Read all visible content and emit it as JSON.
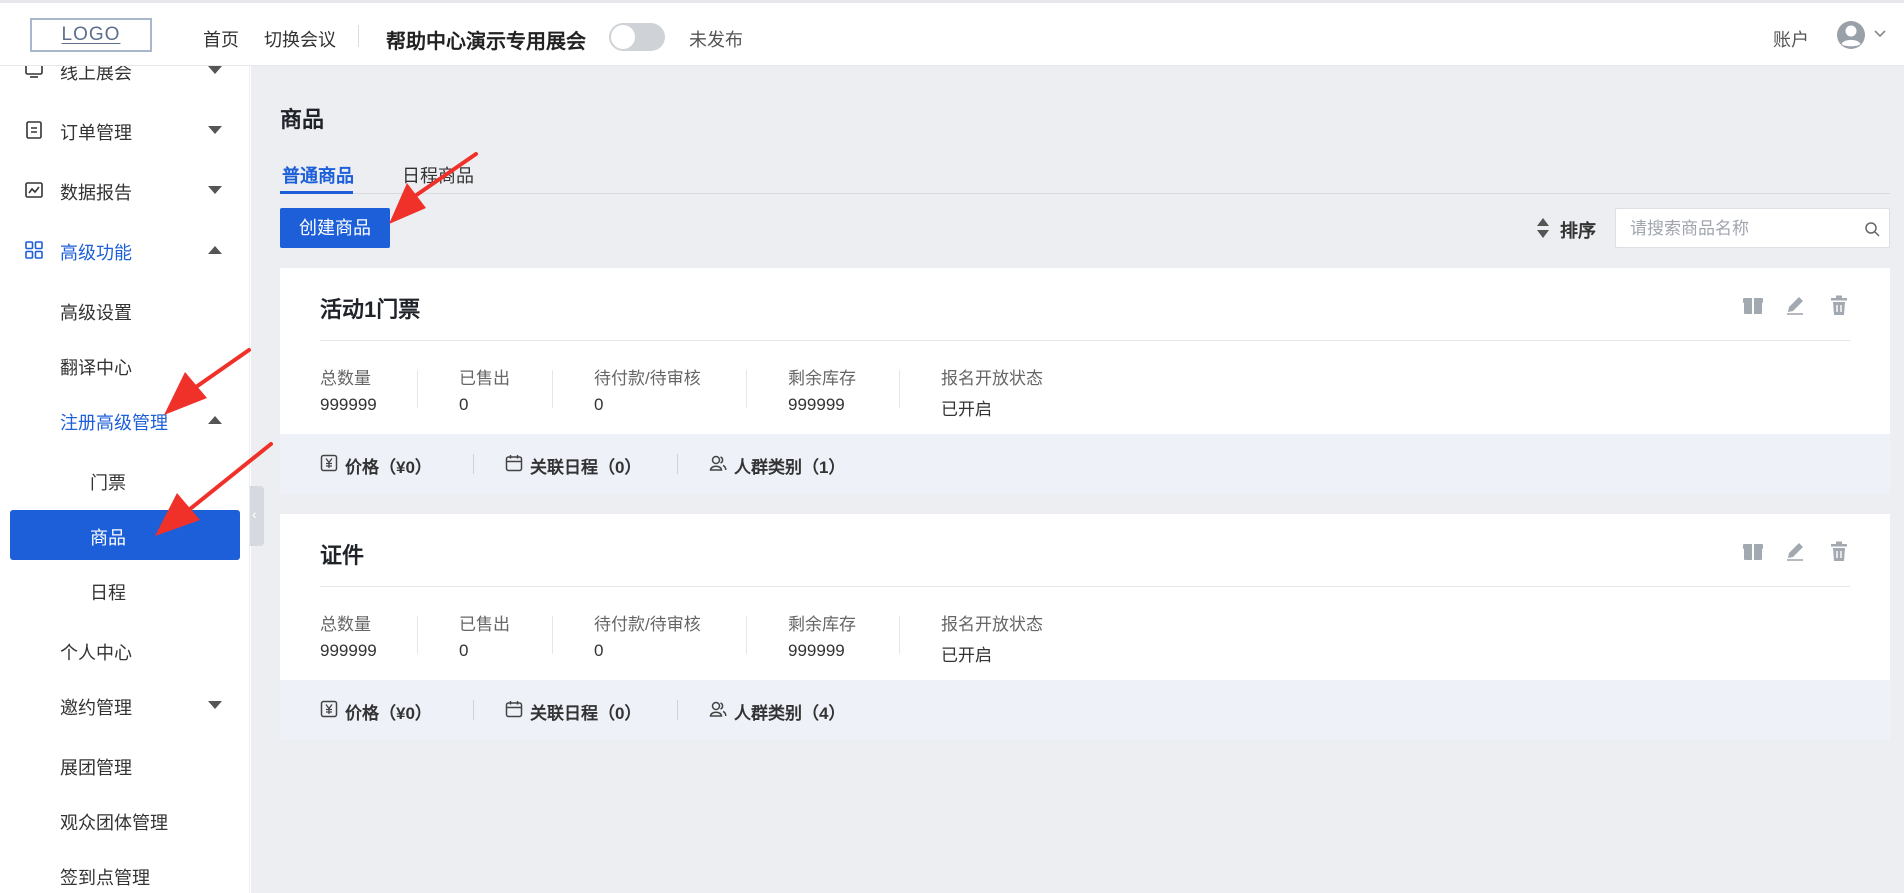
{
  "header": {
    "logo": "LOGO",
    "nav_home": "首页",
    "nav_switch": "切换会议",
    "event_title": "帮助中心演示专用展会",
    "publish_status": "未发布",
    "account": "账户"
  },
  "sidebar": {
    "items": [
      {
        "label": "线上展会",
        "icon": "monitor-icon"
      },
      {
        "label": "订单管理",
        "icon": "order-icon"
      },
      {
        "label": "数据报告",
        "icon": "chart-icon"
      },
      {
        "label": "高级功能",
        "icon": "grid-icon"
      }
    ],
    "sub_items": [
      "高级设置",
      "翻译中心",
      "注册高级管理"
    ],
    "sub_sub_items": [
      "门票",
      "商品",
      "日程"
    ],
    "tail_items": [
      "个人中心",
      "邀约管理",
      "展团管理",
      "观众团体管理",
      "签到点管理"
    ]
  },
  "main": {
    "title": "商品",
    "tabs": [
      {
        "label": "普通商品"
      },
      {
        "label": "日程商品"
      }
    ],
    "create_button": "创建商品",
    "sort_label": "排序",
    "search_placeholder": "请搜索商品名称"
  },
  "products": [
    {
      "name": "活动1门票",
      "stats": [
        {
          "label": "总数量",
          "value": "999999"
        },
        {
          "label": "已售出",
          "value": "0"
        },
        {
          "label": "待付款/待审核",
          "value": "0"
        },
        {
          "label": "剩余库存",
          "value": "999999"
        },
        {
          "label": "报名开放状态",
          "value": "已开启"
        }
      ],
      "footer": {
        "price": "价格（¥0）",
        "schedule": "关联日程（0）",
        "audience": "人群类别（1）"
      }
    },
    {
      "name": "证件",
      "stats": [
        {
          "label": "总数量",
          "value": "999999"
        },
        {
          "label": "已售出",
          "value": "0"
        },
        {
          "label": "待付款/待审核",
          "value": "0"
        },
        {
          "label": "剩余库存",
          "value": "999999"
        },
        {
          "label": "报名开放状态",
          "value": "已开启"
        }
      ],
      "footer": {
        "price": "价格（¥0）",
        "schedule": "关联日程（0）",
        "audience": "人群类别（4）"
      }
    }
  ],
  "colors": {
    "primary": "#1d5fd9",
    "background": "#edeef1",
    "footer_bg": "#eef1f8",
    "annotation": "#f0312a"
  }
}
